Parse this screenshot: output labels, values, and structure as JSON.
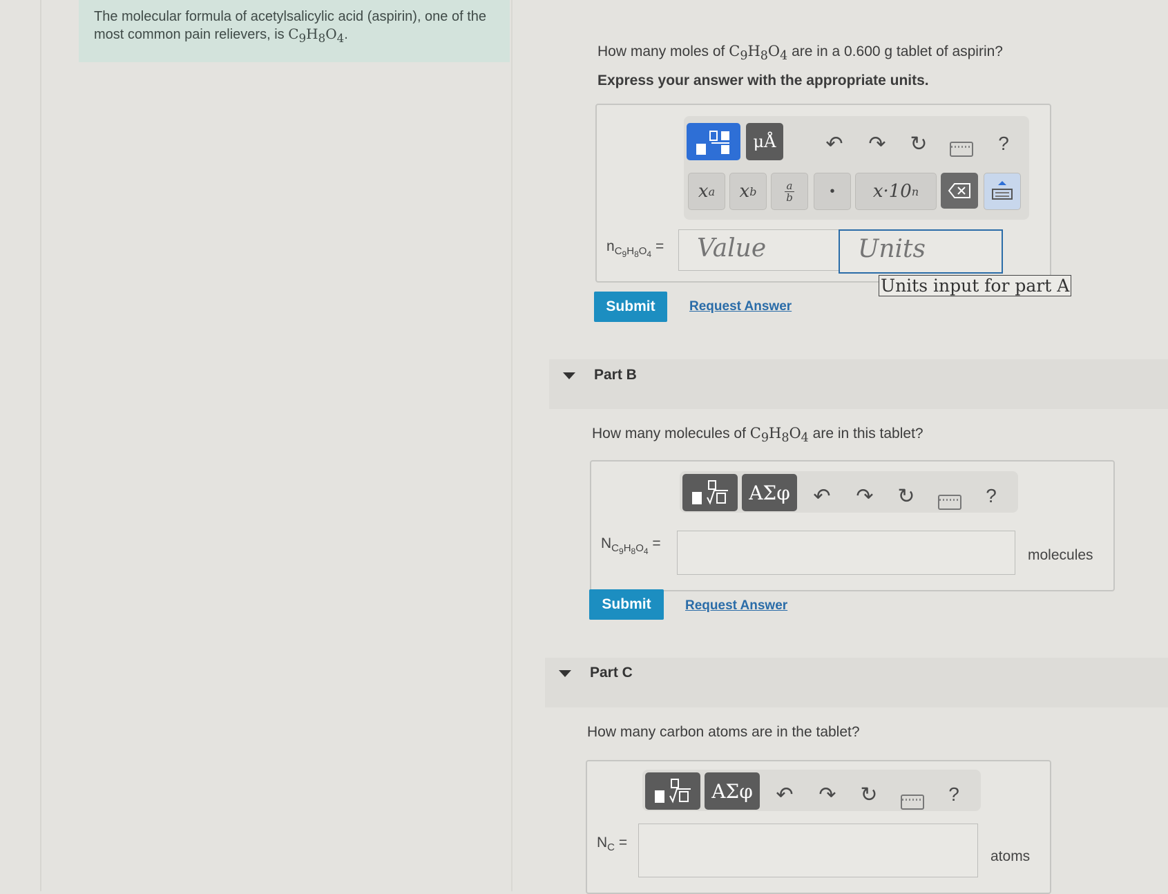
{
  "intro": {
    "text": "The molecular formula of acetylsalicylic acid (aspirin), one of the most common pain relievers, is ",
    "formula": "C9H8O4",
    "period": "."
  },
  "partA": {
    "question_pre": "How many moles of ",
    "formula": "C9H8O4",
    "question_post": " are in a 0.600 g tablet of aspirin?",
    "instruction": "Express your answer with the appropriate units.",
    "var_label": "nC9H8O4 =",
    "value_placeholder": "Value",
    "units_placeholder": "Units",
    "tooltip": "Units input for part A",
    "submit": "Submit",
    "request": "Request Answer",
    "toolbar": {
      "units_btn": "μÅ",
      "superscript": "xa",
      "subscript": "xb",
      "fraction": "a/b",
      "dot": "•",
      "sci": "x·10n",
      "help": "?"
    }
  },
  "partB": {
    "header": "Part B",
    "question_pre": "How many molecules of ",
    "formula": "C9H8O4",
    "question_post": " are in this tablet?",
    "var_label": "NC9H8O4 =",
    "unit": "molecules",
    "greek": "ΑΣφ",
    "help": "?",
    "submit": "Submit",
    "request": "Request Answer"
  },
  "partC": {
    "header": "Part C",
    "question": "How many carbon atoms are in the tablet?",
    "var_label": "NC =",
    "unit": "atoms",
    "greek": "ΑΣφ",
    "help": "?"
  },
  "colors": {
    "accent": "#1c8ec1",
    "intro_bg": "#d3e3dc",
    "template_btn": "#2e6fd6",
    "dark_btn": "#5b5b5b"
  }
}
